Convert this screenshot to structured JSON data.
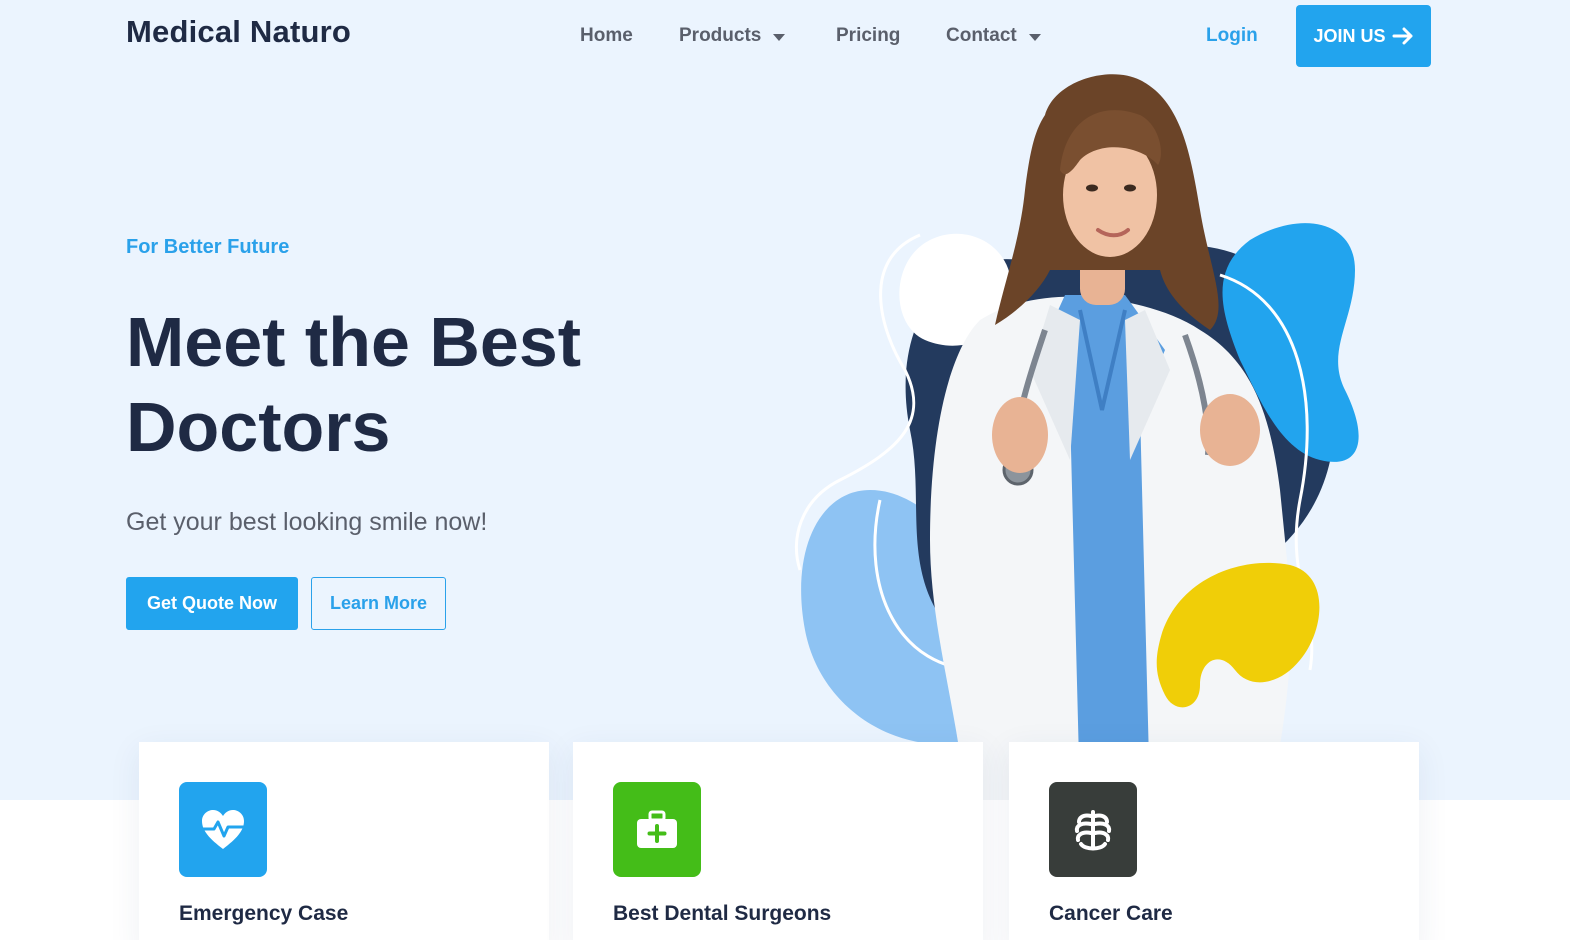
{
  "brand": "Medical Naturo",
  "nav": {
    "items": [
      {
        "label": "Home",
        "has_dropdown": false
      },
      {
        "label": "Products",
        "has_dropdown": true
      },
      {
        "label": "Pricing",
        "has_dropdown": false
      },
      {
        "label": "Contact",
        "has_dropdown": true
      }
    ],
    "login": "Login",
    "join": "JOIN US"
  },
  "hero": {
    "eyebrow": "For Better Future",
    "title_line1": "Meet the Best",
    "title_line2": "Doctors",
    "subtitle": "Get your best looking smile now!",
    "primary_button": "Get Quote Now",
    "secondary_button": "Learn More"
  },
  "cards": [
    {
      "title": "Emergency Case",
      "icon": "heart-pulse-icon",
      "color": "#22a4ee"
    },
    {
      "title": "Best Dental Surgeons",
      "icon": "medical-kit-icon",
      "color": "#44bd18"
    },
    {
      "title": "Cancer Care",
      "icon": "ribcage-icon",
      "color": "#383d3a"
    }
  ],
  "colors": {
    "accent": "#22a4ee",
    "hero_bg": "#ebf4fe",
    "heading": "#1f2a44",
    "blob_dark": "#233a5e",
    "blob_light": "#8ec3f3",
    "blob_yellow": "#f0ce08"
  }
}
